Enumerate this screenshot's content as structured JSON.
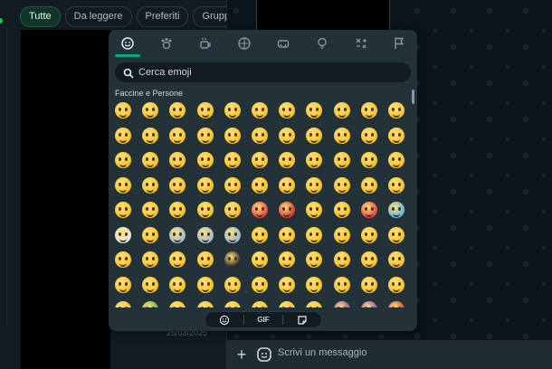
{
  "filters": [
    "Tutte",
    "Da leggere",
    "Preferiti",
    "Gruppi"
  ],
  "chat_list": {
    "date": "25/03/2025"
  },
  "composer": {
    "placeholder": "Scrivi un messaggio"
  },
  "emoji_picker": {
    "search_placeholder": "Cerca emoji",
    "section_title": "Faccine e Persone",
    "category_tabs": [
      "smiley-icon",
      "animal-icon",
      "food-icon",
      "ball-icon",
      "car-icon",
      "bulb-icon",
      "symbols-icon",
      "flag-icon"
    ],
    "bottom_tabs": {
      "gif_label": "GIF"
    },
    "emoji_rows": [
      [
        "#f7c325",
        "#f7c325",
        "#f7c325",
        "#f7c325",
        "#f7c325",
        "#f7c325",
        "#f7c325",
        "#f7c325",
        "#f7c325",
        "#f7c325",
        "#f7c325"
      ],
      [
        "#f7c325",
        "#f7c325",
        "#f7c325",
        "#f7c325",
        "#f7c325",
        "#f7c325",
        "#f7c325",
        "#f7c325",
        "#f7c325",
        "#f7c325",
        "#f7c325"
      ],
      [
        "#f7c325",
        "#f7c325",
        "#f7c325",
        "#f7c325",
        "#f7c325",
        "#f7c325",
        "#f7c325",
        "#f7c325",
        "#f7c325",
        "#f7c325",
        "#f7c325"
      ],
      [
        "#f7c325",
        "#f7c325",
        "#f7c325",
        "#f7c325",
        "#f7c325",
        "#f7c325",
        "#f7c325",
        "#f7c325",
        "#f7c325",
        "#f7c325",
        "#f7c325"
      ],
      [
        "#f7c325",
        "#f7c325",
        "#f7c325",
        "#f7c325",
        "#f7c325",
        "#e8453c",
        "#d9362f",
        "#f7c325",
        "#f7c325",
        "#e8453c",
        "#5ab9e6"
      ],
      [
        "#e6e6e6",
        "#f7c325",
        "#9db8d9",
        "#9db8d9",
        "#8fb9d9",
        "#f7c325",
        "#f7c325",
        "#f7c325",
        "#f7c325",
        "#f7c325",
        "#f7c325"
      ],
      [
        "#f7c325",
        "#f7c325",
        "#f7c325",
        "#f7c325",
        "#2a2a2a",
        "#f7c325",
        "#f7c325",
        "#f7c325",
        "#f7c325",
        "#f7c325",
        "#f7c325"
      ],
      [
        "#f7c325",
        "#f7c325",
        "#f7c325",
        "#f7c325",
        "#f7c325",
        "#f7c325",
        "#f7c325",
        "#f7c325",
        "#f7c325",
        "#f7c325",
        "#f7c325"
      ],
      [
        "#f7c325",
        "#6aa84f",
        "#f7c325",
        "#f7c325",
        "#f7c325",
        "#f7c325",
        "#f7c325",
        "#f7c325",
        "#8e44ad",
        "#8e44ad",
        "#d9362f"
      ]
    ]
  },
  "colors": {
    "accent": "#00a884",
    "panel": "#233138",
    "background": "#111b21"
  }
}
